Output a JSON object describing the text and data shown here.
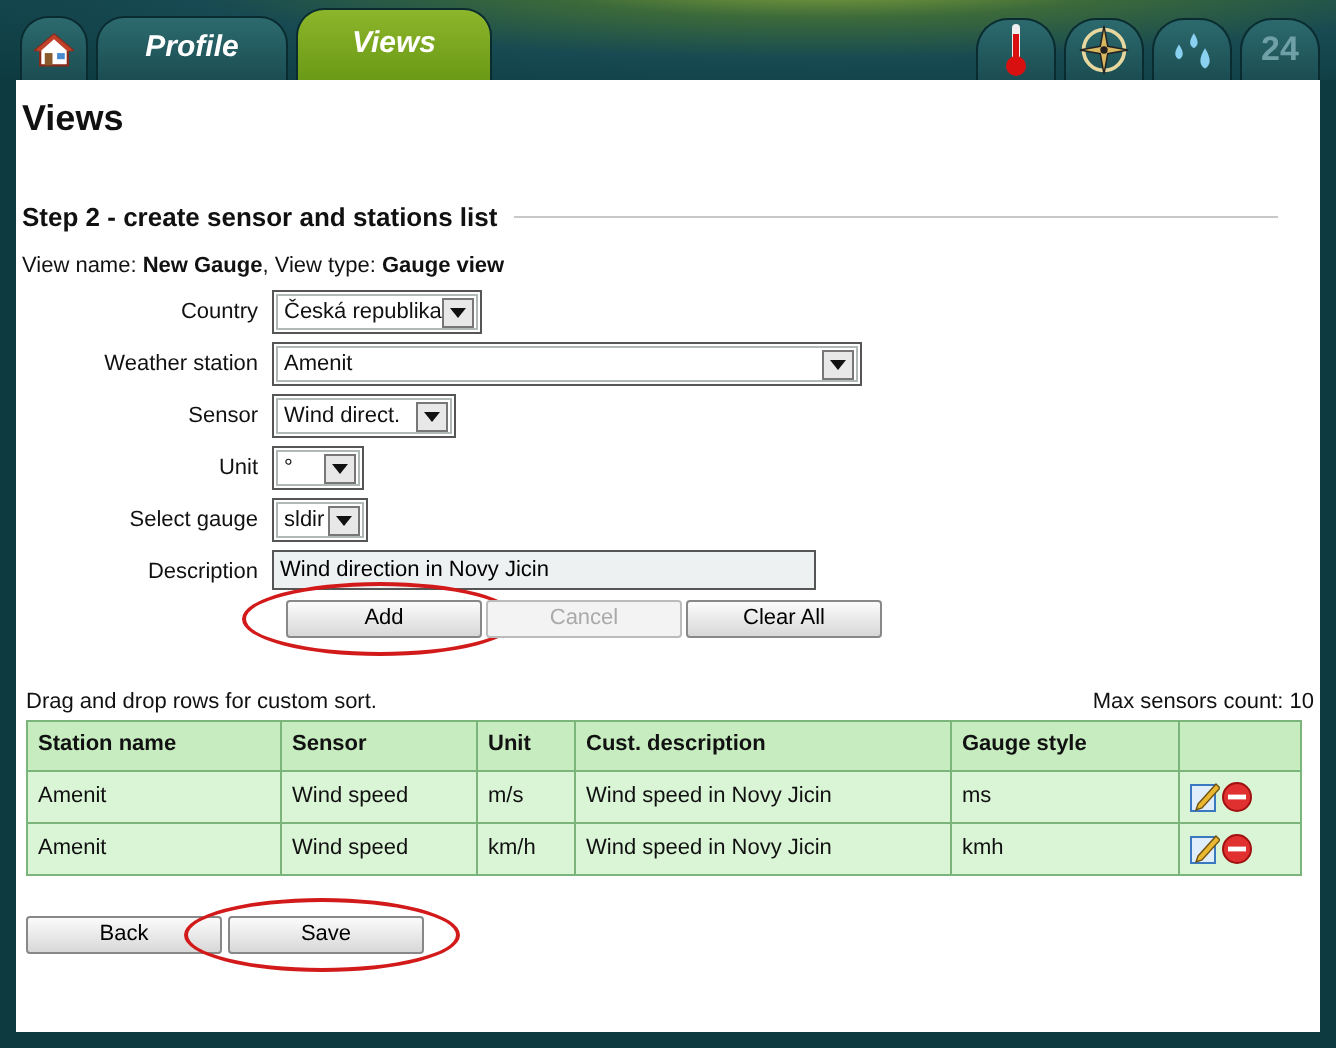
{
  "top_tabs": [
    {
      "kind": "home",
      "selected": false
    },
    {
      "kind": "text",
      "label": "Profile",
      "selected": false
    },
    {
      "kind": "text",
      "label": "Views",
      "selected": true
    }
  ],
  "icon_tabs": [
    {
      "kind": "thermometer"
    },
    {
      "kind": "compass"
    },
    {
      "kind": "drops"
    },
    {
      "kind": "text",
      "label": "24"
    }
  ],
  "page_title": "Views",
  "step_heading": "Step 2 - create sensor and stations list",
  "view_info": "View name: **New Gauge**, View type: **Gauge view**",
  "fields": [
    {
      "label": "Country",
      "kind": "select",
      "value": "Česká republika"
    },
    {
      "label": "Weather station",
      "kind": "select",
      "value": "Amenit"
    },
    {
      "label": "Sensor",
      "kind": "select",
      "value": "Wind direct."
    },
    {
      "label": "Unit",
      "kind": "select",
      "value": "°"
    },
    {
      "label": "Select gauge",
      "kind": "select",
      "value": "sldir"
    },
    {
      "label": "Description",
      "kind": "text",
      "value": "Wind direction in Novy Jicin"
    }
  ],
  "form_buttons": [
    {
      "label": "Add",
      "disabled": false,
      "circled": true
    },
    {
      "label": "Cancel",
      "disabled": true,
      "circled": false
    },
    {
      "label": "Clear All",
      "disabled": false,
      "circled": false
    }
  ],
  "table_note": "Drag and drop rows for custom sort.",
  "max_count": "Max sensors count: 10",
  "table": {
    "columns": [
      "Station name",
      "Sensor",
      "Unit",
      "Cust. description",
      "Gauge style"
    ],
    "rows": [
      {
        "cells": [
          "Amenit",
          "Wind speed",
          "m/s",
          "Wind speed in Novy Jicin",
          "ms"
        ]
      },
      {
        "cells": [
          "Amenit",
          "Wind speed",
          "km/h",
          "Wind speed in Novy Jicin",
          "kmh"
        ]
      }
    ]
  },
  "bottom_buttons": [
    {
      "label": "Back",
      "circled": false
    },
    {
      "label": "Save",
      "circled": true
    }
  ]
}
